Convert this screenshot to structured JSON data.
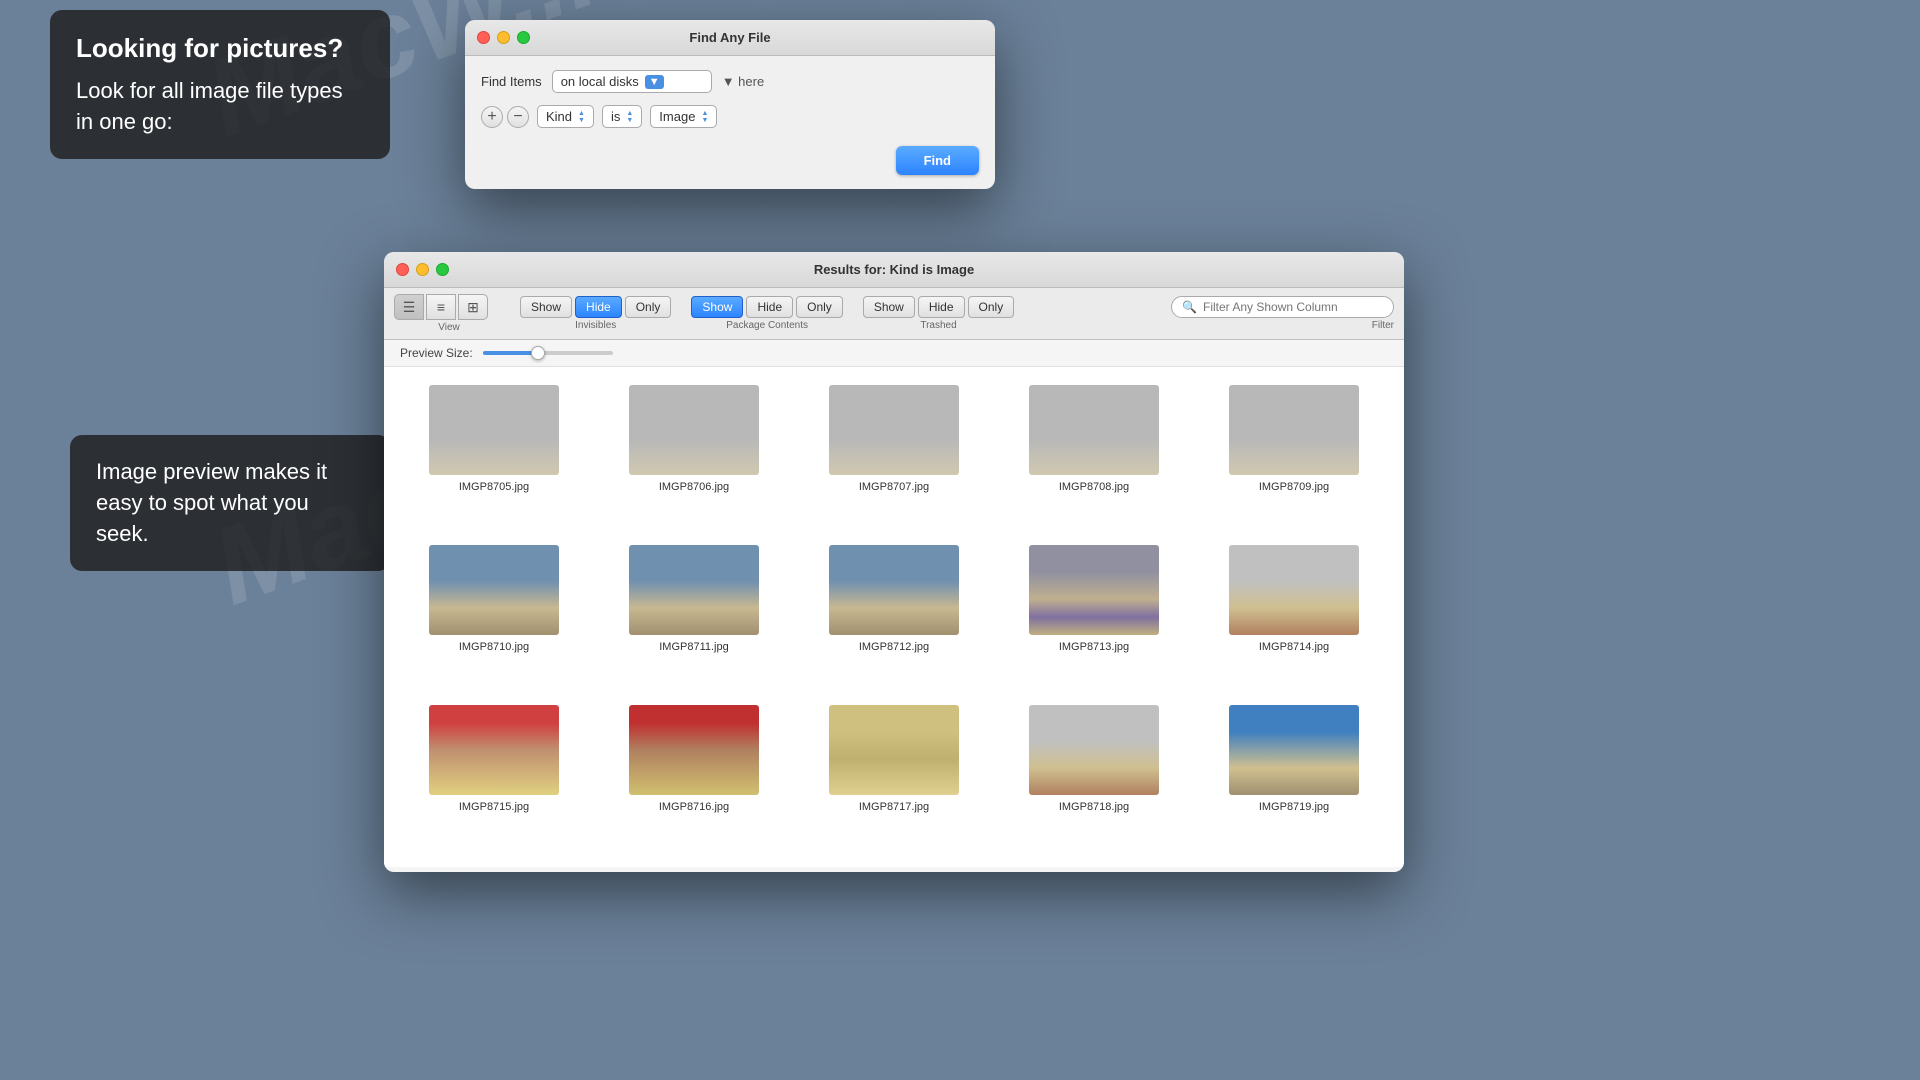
{
  "watermarks": [
    "MacW...",
    "MacW...com..."
  ],
  "info_box_1": {
    "heading": "Looking for pictures?",
    "body": "Look for all image file types in one go:"
  },
  "info_box_2": {
    "heading": "Image preview makes it easy to spot what you seek."
  },
  "find_dialog": {
    "title": "Find Any File",
    "find_items_label": "Find Items",
    "location": "on local disks",
    "elsewhere_label": "▼ here",
    "criteria": {
      "field": "Kind",
      "operator": "is",
      "value": "Image"
    },
    "find_button": "Find"
  },
  "results_window": {
    "title": "Results for: Kind is Image",
    "toolbar": {
      "view_label": "View",
      "invisibles_label": "Invisibles",
      "package_contents_label": "Package Contents",
      "trashed_label": "Trashed",
      "filter_label": "Filter",
      "filter_placeholder": "Filter Any Shown Column",
      "show_btn": "Show",
      "hide_btn": "Hide",
      "only_btn": "Only"
    },
    "preview_size_label": "Preview Size:",
    "images": [
      {
        "name": "IMGP8705.jpg",
        "style": "thumb-gray"
      },
      {
        "name": "IMGP8706.jpg",
        "style": "thumb-gray"
      },
      {
        "name": "IMGP8707.jpg",
        "style": "thumb-gray"
      },
      {
        "name": "IMGP8708.jpg",
        "style": "thumb-gray"
      },
      {
        "name": "IMGP8709.jpg",
        "style": "thumb-gray"
      },
      {
        "name": "IMGP8710.jpg",
        "style": "thumb-sky"
      },
      {
        "name": "IMGP8711.jpg",
        "style": "thumb-sky"
      },
      {
        "name": "IMGP8712.jpg",
        "style": "thumb-sky"
      },
      {
        "name": "IMGP8713.jpg",
        "style": "thumb-truck"
      },
      {
        "name": "IMGP8714.jpg",
        "style": "thumb-truck2"
      },
      {
        "name": "IMGP8715.jpg",
        "style": "thumb-van"
      },
      {
        "name": "IMGP8716.jpg",
        "style": "thumb-van2"
      },
      {
        "name": "IMGP8717.jpg",
        "style": "thumb-yellow"
      },
      {
        "name": "IMGP8718.jpg",
        "style": "thumb-truck2"
      },
      {
        "name": "IMGP8719.jpg",
        "style": "thumb-sky2"
      }
    ]
  }
}
